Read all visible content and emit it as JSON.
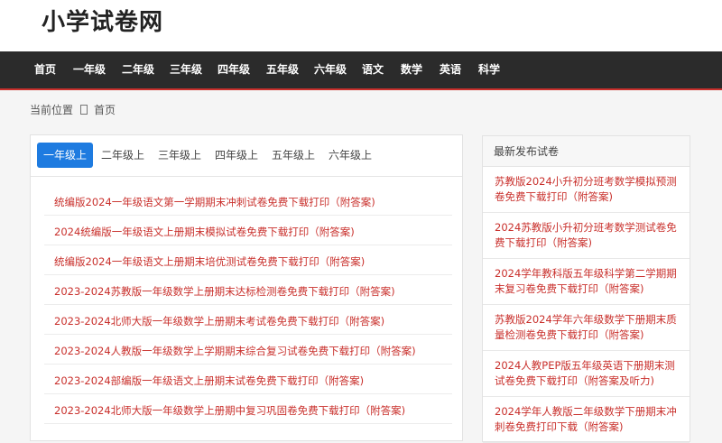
{
  "site": {
    "title": "小学试卷网"
  },
  "nav": [
    "首页",
    "一年级",
    "二年级",
    "三年级",
    "四年级",
    "五年级",
    "六年级",
    "语文",
    "数学",
    "英语",
    "科学"
  ],
  "breadcrumb": {
    "label": "当前位置",
    "home": "首页"
  },
  "tabs": [
    "一年级上",
    "二年级上",
    "三年级上",
    "四年级上",
    "五年级上",
    "六年级上"
  ],
  "active_tab": "一年级上",
  "articles": [
    "统编版2024一年级语文第一学期期末冲刺试卷免费下载打印（附答案)",
    "2024统编版一年级语文上册期末模拟试卷免费下载打印（附答案)",
    "统编版2024一年级语文上册期末培优测试卷免费下载打印（附答案)",
    "2023-2024苏教版一年级数学上册期末达标检测卷免费下载打印（附答案)",
    "2023-2024北师大版一年级数学上册期末考试卷免费下载打印（附答案)",
    "2023-2024人教版一年级数学上学期期末综合复习试卷免费下载打印（附答案)",
    "2023-2024部编版一年级语文上册期末试卷免费下载打印（附答案)",
    "2023-2024北师大版一年级数学上册期中复习巩固卷免费下载打印（附答案)"
  ],
  "sidebar": {
    "title": "最新发布试卷",
    "items": [
      "苏教版2024小升初分班考数学模拟预测卷免费下载打印（附答案)",
      "2024苏教版小升初分班考数学测试卷免费下载打印（附答案)",
      "2024学年教科版五年级科学第二学期期末复习卷免费下载打印（附答案)",
      "苏教版2024学年六年级数学下册期末质量检测卷免费下载打印（附答案)",
      "2024人教PEP版五年级英语下册期末测试卷免费下载打印（附答案及听力)",
      "2024学年人教版二年级数学下册期末冲刺卷免费打印下载（附答案)"
    ]
  },
  "colors": {
    "nav_bg": "#2b2b2b",
    "accent_red": "#c9302c",
    "tab_active": "#1e7be0"
  }
}
